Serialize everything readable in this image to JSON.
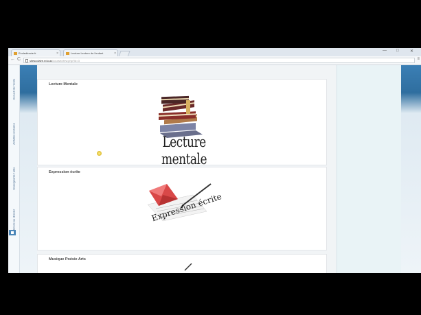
{
  "browser": {
    "tabs": [
      {
        "title": "Ecoledirecte.fr"
      },
      {
        "title": "Lecture Lecture de l'enfant"
      }
    ],
    "window_controls": [
      "—",
      "□",
      "✕"
    ],
    "nav": {
      "back": "←",
      "forward": "→",
      "reload": "C"
    },
    "url": {
      "host": "sitescolaire.edu.ac",
      "path": "/course/view.php?id=3"
    },
    "menu_icon": "≡"
  },
  "side_tabs": [
    "Accueil de l'école",
    "Activités scolaires",
    "Enseignants / aide",
    "Accès au dossier"
  ],
  "sections": [
    {
      "title": "Lecture Mentale",
      "image_caption": "Lecture mentale"
    },
    {
      "title": "Expression écrite",
      "image_caption": "Expression écrite"
    },
    {
      "title": "Musique Poésie Arts"
    }
  ],
  "colors": {
    "accent": "#3b7fb5",
    "panel": "#e9f3f6"
  }
}
